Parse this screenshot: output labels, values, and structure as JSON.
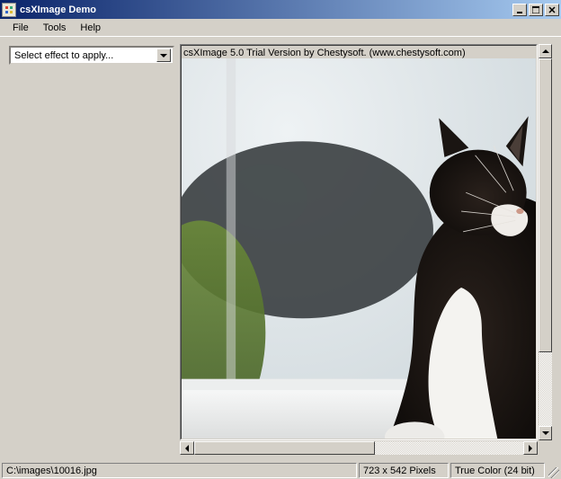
{
  "window": {
    "title": "csXImage Demo"
  },
  "menu": {
    "file": "File",
    "tools": "Tools",
    "help": "Help"
  },
  "effect_select": {
    "placeholder": "Select effect to apply..."
  },
  "viewer": {
    "watermark": "csXImage 5.0 Trial Version by Chestysoft. (www.chestysoft.com)"
  },
  "status": {
    "path": "C:\\images\\10016.jpg",
    "dimensions": "723 x 542 Pixels",
    "color_mode": "True Color (24 bit)"
  }
}
